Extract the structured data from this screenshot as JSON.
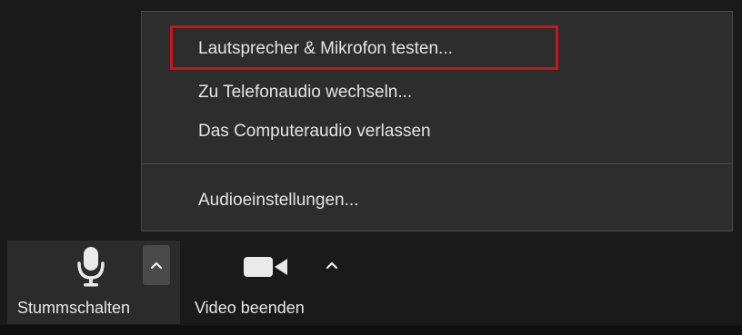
{
  "audio_menu": {
    "items": [
      {
        "label": "Lautsprecher & Mikrofon testen..."
      },
      {
        "label": "Zu Telefonaudio wechseln..."
      },
      {
        "label": "Das Computeraudio verlassen"
      },
      {
        "label": "Audioeinstellungen..."
      }
    ],
    "highlighted_index": 0
  },
  "toolbar": {
    "mute_label": "Stummschalten",
    "video_label": "Video beenden",
    "audio_caret_expanded": true
  },
  "colors": {
    "menu_background": "#2d2d2d",
    "highlight_border": "#c8141c",
    "toolbar_background": "#1a1a1a",
    "text": "#e4e4e4"
  },
  "icons": [
    "microphone-icon",
    "chevron-up-icon",
    "video-camera-icon"
  ]
}
